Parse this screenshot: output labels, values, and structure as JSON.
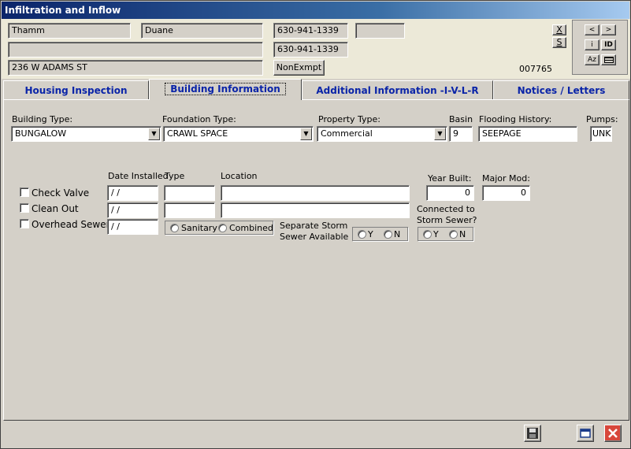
{
  "window": {
    "title": "Infiltration and Inflow"
  },
  "header": {
    "last_name": "Thamm",
    "first_name": "Duane",
    "phone1": "630-941-1339",
    "phone2": "630-941-1339",
    "extra": "",
    "line2": "",
    "address": "236 W ADAMS ST",
    "exempt_button": "NonExmpt",
    "record_id": "007765",
    "x_button": "X",
    "s_button": "S"
  },
  "mini_panel": {
    "prev": "<",
    "next": ">",
    "info": "i",
    "id": "ID",
    "sort": "Az"
  },
  "tabs": [
    {
      "label": "Housing Inspection"
    },
    {
      "label": "Building Information"
    },
    {
      "label": "Additional Information -I-V-L-R"
    },
    {
      "label": "Notices / Letters"
    }
  ],
  "building": {
    "building_type_label": "Building Type:",
    "building_type_value": "BUNGALOW",
    "foundation_type_label": "Foundation Type:",
    "foundation_type_value": "CRAWL SPACE",
    "property_type_label": "Property Type:",
    "property_type_value": "Commercial",
    "basin_label": "Basin",
    "basin_value": "9",
    "flooding_label": "Flooding History:",
    "flooding_value": "SEEPAGE",
    "pumps_label": "Pumps:",
    "pumps_value": "UNK"
  },
  "fixtures": {
    "date_installed_header": "Date Installed",
    "type_header": "Type",
    "location_header": "Location",
    "check_valve_label": "Check Valve",
    "clean_out_label": "Clean Out",
    "overhead_sewer_label": "Overhead Sewer",
    "date_value": " / /",
    "sanitary_label": "Sanitary",
    "combined_label": "Combined",
    "separate_storm_label": "Separate Storm",
    "sewer_available_label": "Sewer Available",
    "y_label": "Y",
    "n_label": "N",
    "year_built_label": "Year Built:",
    "year_built_value": "0",
    "major_mod_label": "Major Mod:",
    "major_mod_value": "0",
    "connected_label": "Connected to",
    "storm_sewer_label": "Storm Sewer?"
  }
}
